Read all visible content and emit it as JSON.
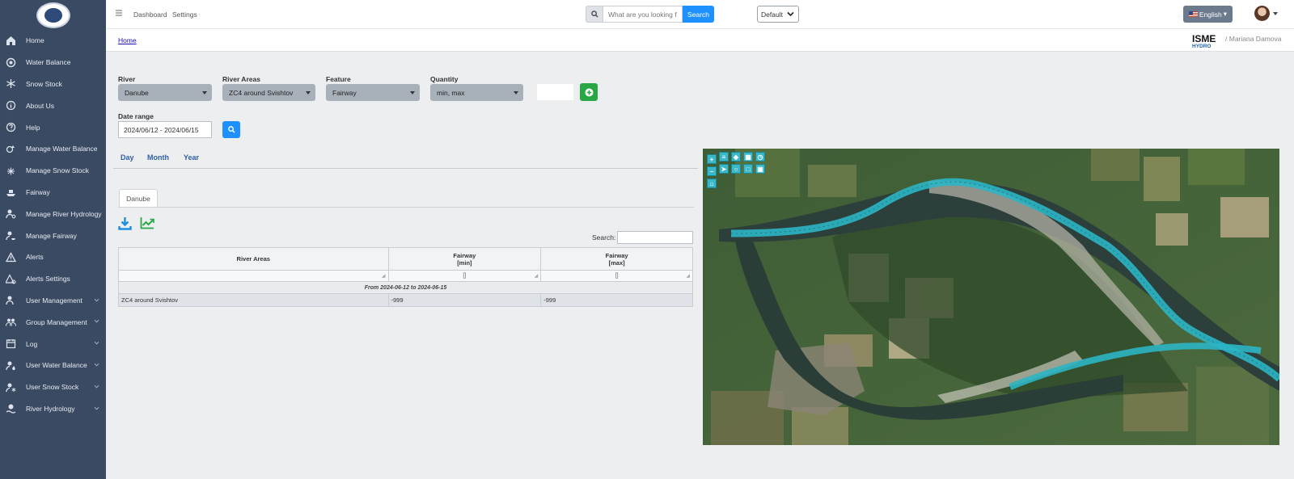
{
  "sidebar": {
    "items": [
      {
        "label": "Home",
        "icon": "home-icon"
      },
      {
        "label": "Water Balance",
        "icon": "water-balance-icon"
      },
      {
        "label": "Snow Stock",
        "icon": "snowflake-icon"
      },
      {
        "label": "About Us",
        "icon": "info-icon"
      },
      {
        "label": "Help",
        "icon": "help-icon"
      },
      {
        "label": "Manage Water Balance",
        "icon": "manage-water-icon"
      },
      {
        "label": "Manage Snow Stock",
        "icon": "manage-snow-icon"
      },
      {
        "label": "Fairway",
        "icon": "ship-icon"
      },
      {
        "label": "Manage River Hydrology",
        "icon": "user-cog-icon"
      },
      {
        "label": "Manage Fairway",
        "icon": "user-ship-icon"
      },
      {
        "label": "Alerts",
        "icon": "warning-icon"
      },
      {
        "label": "Alerts Settings",
        "icon": "alert-settings-icon"
      },
      {
        "label": "User Management",
        "icon": "users-icon"
      },
      {
        "label": "Group Management",
        "icon": "group-icon"
      },
      {
        "label": "Log",
        "icon": "log-icon"
      },
      {
        "label": "User Water Balance",
        "icon": "user-water-icon"
      },
      {
        "label": "User Snow Stock",
        "icon": "user-snow-icon"
      },
      {
        "label": "River Hydrology",
        "icon": "hydrology-icon"
      }
    ]
  },
  "topbar": {
    "links": [
      "Dashboard",
      "Settings"
    ],
    "search_placeholder": "What are you looking f",
    "search_button": "Search",
    "default_select": "Default",
    "language": "English"
  },
  "breadcrumb": {
    "home": "Home",
    "logo_text": "ISME HYDRO",
    "user": "Mariana Damova"
  },
  "filters": {
    "river_label": "River",
    "river_value": "Danube",
    "areas_label": "River Areas",
    "areas_value": "ZC4 around Svishtov",
    "feature_label": "Feature",
    "feature_value": "Fairway",
    "quantity_label": "Quantity",
    "quantity_value": "min, max",
    "date_label": "Date range",
    "date_value": "2024/06/12 - 2024/06/15"
  },
  "period_tabs": [
    "Day",
    "Month",
    "Year"
  ],
  "result_tab": "Danube",
  "table": {
    "search_label": "Search:",
    "headers": [
      {
        "line1": "River Areas",
        "line2": ""
      },
      {
        "line1": "Fairway",
        "line2": "[min]"
      },
      {
        "line1": "Fairway",
        "line2": "[max]"
      }
    ],
    "filter_placeholders": [
      "",
      "[]",
      "[]"
    ],
    "group_label": "From 2024-06-12 to 2024-06-15",
    "rows": [
      [
        "ZC4 around Svishtov",
        "-999",
        "-999"
      ]
    ]
  },
  "colors": {
    "sidebar_bg": "#3b4a63",
    "accent_blue": "#1e90ff",
    "accent_green": "#28a745",
    "fairway_cyan": "#2bb5c4"
  }
}
